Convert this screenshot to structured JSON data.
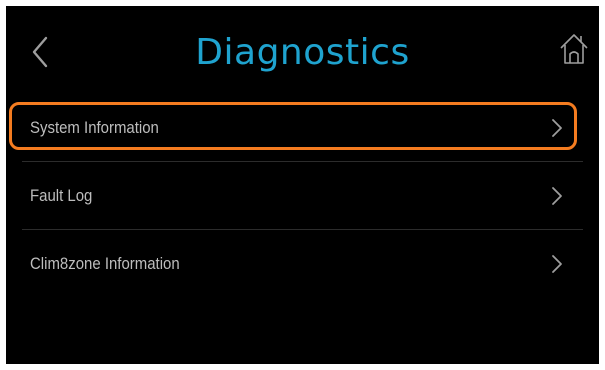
{
  "header": {
    "title": "Diagnostics",
    "back_icon": "chevron-left-icon",
    "home_icon": "home-icon"
  },
  "menu": {
    "items": [
      {
        "label": "System Information",
        "icon": "chevron-right-icon",
        "highlighted": true
      },
      {
        "label": "Fault Log",
        "icon": "chevron-right-icon",
        "highlighted": false
      },
      {
        "label": "Clim8zone Information",
        "icon": "chevron-right-icon",
        "highlighted": false
      }
    ]
  },
  "colors": {
    "background": "#000000",
    "title": "#1fa3cf",
    "highlight": "#f47c20",
    "text": "#bdbdbd",
    "icon": "#9e9e9e"
  }
}
